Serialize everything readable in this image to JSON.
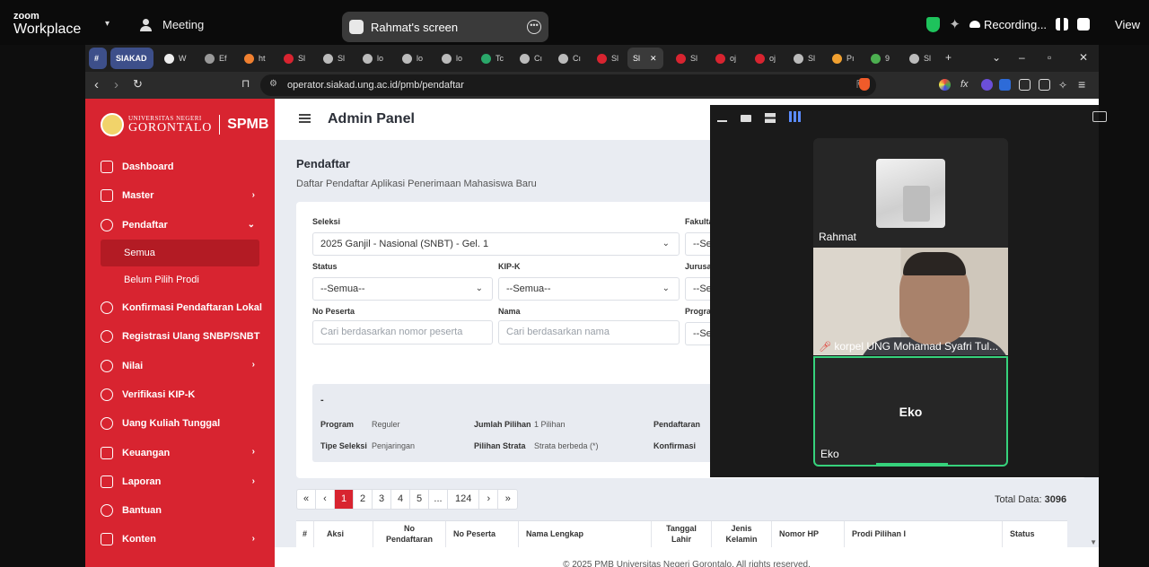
{
  "zoom": {
    "brand_line1": "zoom",
    "brand_line2": "Workplace",
    "meeting_label": "Meeting",
    "share_title": "Rahmat's screen",
    "recording_label": "Recording...",
    "view_label": "View"
  },
  "browser": {
    "tabs": [
      {
        "label": "#"
      },
      {
        "label": "SIAKAD"
      },
      {
        "label": "W"
      },
      {
        "label": "Ef"
      },
      {
        "label": "ht"
      },
      {
        "label": "Sl"
      },
      {
        "label": "Sl"
      },
      {
        "label": "lo"
      },
      {
        "label": "lo"
      },
      {
        "label": "lo"
      },
      {
        "label": "Tc"
      },
      {
        "label": "Cı"
      },
      {
        "label": "Cı"
      },
      {
        "label": "Sl"
      },
      {
        "label": "Sl"
      },
      {
        "label": "Sl"
      },
      {
        "label": "oj"
      },
      {
        "label": "oj"
      },
      {
        "label": "Sl"
      },
      {
        "label": "Pı"
      },
      {
        "label": "9"
      },
      {
        "label": "Sl"
      }
    ],
    "url": "operator.siakad.ung.ac.id/pmb/pendaftar"
  },
  "sidebar": {
    "brand_small": "UNIVERSITAS NEGERI",
    "brand_big": "GORONTALO",
    "brand_app": "SPMB",
    "items": [
      {
        "label": "Dashboard"
      },
      {
        "label": "Master"
      },
      {
        "label": "Pendaftar"
      },
      {
        "label": "Semua"
      },
      {
        "label": "Belum Pilih Prodi"
      },
      {
        "label": "Konfirmasi Pendaftaran Lokal"
      },
      {
        "label": "Registrasi Ulang SNBP/SNBT"
      },
      {
        "label": "Nilai"
      },
      {
        "label": "Verifikasi KIP-K"
      },
      {
        "label": "Uang Kuliah Tunggal"
      },
      {
        "label": "Keuangan"
      },
      {
        "label": "Laporan"
      },
      {
        "label": "Bantuan"
      },
      {
        "label": "Konten"
      }
    ]
  },
  "header": {
    "title": "Admin Panel"
  },
  "main": {
    "title": "Pendaftar",
    "subtitle": "Daftar Pendaftar Aplikasi Penerimaan Mahasiswa Baru"
  },
  "filters": {
    "seleksi_label": "Seleksi",
    "seleksi_value": "2025 Ganjil - Nasional (SNBT) - Gel. 1",
    "fakultas_label": "Fakulta",
    "fakultas_value": "--Se",
    "status_label": "Status",
    "status_value": "--Semua--",
    "kipk_label": "KIP-K",
    "kipk_value": "--Semua--",
    "jurusan_label": "Jurusa",
    "jurusan_value": "--Se",
    "nopeserta_label": "No Peserta",
    "nopeserta_placeholder": "Cari berdasarkan nomor peserta",
    "nama_label": "Nama",
    "nama_placeholder": "Cari berdasarkan nama",
    "prodi_label": "Progra",
    "prodi_value": "--Se"
  },
  "info": {
    "dash": "-",
    "program_k": "Program",
    "program_v": "Reguler",
    "tipe_k": "Tipe Seleksi",
    "tipe_v": "Penjaringan",
    "jumlah_k": "Jumlah Pilihan",
    "jumlah_v": "1 Pilihan",
    "strata_k": "Pilihan Strata",
    "strata_v": "Strata berbeda (*)",
    "pendaftaran_k": "Pendaftaran",
    "konfirmasi_k": "Konfirmasi"
  },
  "pagination": {
    "first": "«",
    "prev": "‹",
    "pages": [
      "1",
      "2",
      "3",
      "4",
      "5",
      "...",
      "124"
    ],
    "next": "›",
    "last": "»",
    "total_label": "Total Data:",
    "total_value": "3096"
  },
  "table": {
    "headers": [
      "#",
      "Aksi",
      "No Pendaftaran",
      "No Peserta",
      "Nama Lengkap",
      "Tanggal Lahir",
      "Jenis Kelamin",
      "Nomor HP",
      "Prodi Pilihan I",
      "Status"
    ]
  },
  "footer": {
    "text": "© 2025 PMB Universitas Negeri Gorontalo. All rights reserved."
  },
  "video": {
    "tile1_name": "Rahmat",
    "tile2_name": "korpel UNG Mohamad Syafri Tul...",
    "tile3_center": "Eko",
    "tile3_name": "Eko"
  },
  "colors": {
    "accent": "#d82430",
    "speaker": "#36d27c"
  }
}
